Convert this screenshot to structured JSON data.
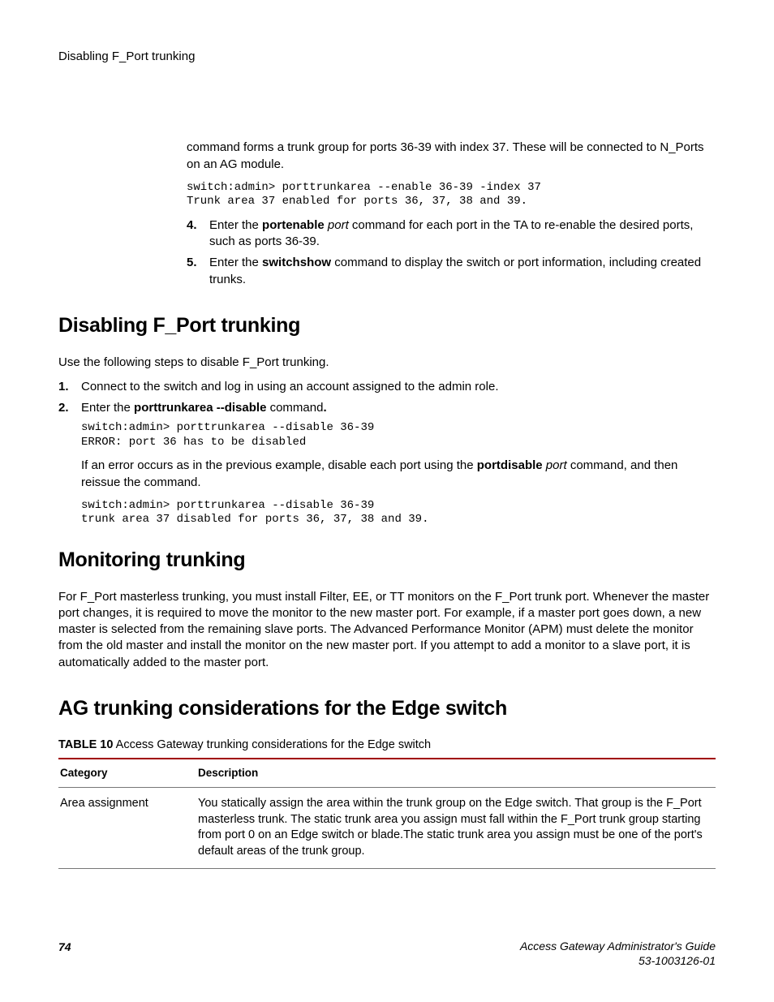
{
  "header": {
    "breadcrumb": "Disabling F_Port trunking"
  },
  "intro": {
    "p1": "command forms a trunk group for ports 36-39 with index 37. These will be connected to N_Ports on an AG module.",
    "code1": "switch:admin> porttrunkarea --enable 36-39 -index 37\nTrunk area 37 enabled for ports 36, 37, 38 and 39.",
    "step4_marker": "4.",
    "step4_pre": "Enter the ",
    "step4_b1": "portenable",
    "step4_i1": " port ",
    "step4_post": "command for each port in the TA to re-enable the desired ports, such as ports 36-39.",
    "step5_marker": "5.",
    "step5_pre": "Enter the ",
    "step5_b1": "switchshow",
    "step5_post": " command to display the switch or port information, including created trunks."
  },
  "disabling": {
    "heading": "Disabling F_Port trunking",
    "p1": "Use the following steps to disable F_Port trunking.",
    "s1_marker": "1.",
    "s1_text": "Connect to the switch and log in using an account assigned to the admin role.",
    "s2_marker": "2.",
    "s2_pre": "Enter the ",
    "s2_b1": "porttrunkarea --disable",
    "s2_post": " command",
    "s2_bperiod": ".",
    "code1": "switch:admin> porttrunkarea --disable 36-39\nERROR: port 36 has to be disabled",
    "p2_pre": "If an error occurs as in the previous example, disable each port using the ",
    "p2_b1": "portdisable",
    "p2_i1": " port ",
    "p2_post": "command, and then reissue the command.",
    "code2": "switch:admin> porttrunkarea --disable 36-39\ntrunk area 37 disabled for ports 36, 37, 38 and 39."
  },
  "monitoring": {
    "heading": "Monitoring trunking",
    "p1": "For F_Port masterless trunking, you must install Filter, EE, or TT monitors on the F_Port trunk port. Whenever the master port changes, it is required to move the monitor to the new master port. For example, if a master port goes down, a new master is selected from the remaining slave ports. The Advanced Performance Monitor (APM) must delete the monitor from the old master and install the monitor on the new master port. If you attempt to add a monitor to a slave port, it is automatically added to the master port."
  },
  "ag": {
    "heading": "AG trunking considerations for the Edge switch",
    "caption_label": "TABLE 10",
    "caption_text": "   Access Gateway trunking considerations for the Edge switch",
    "th_cat": "Category",
    "th_desc": "Description",
    "row1_cat": "Area assignment",
    "row1_desc": "You statically assign the area within the trunk group on the Edge switch. That group is the F_Port masterless trunk. The static trunk area you assign must fall within the F_Port trunk group starting from port 0 on an Edge switch or blade.The static trunk area you assign must be one of the port's default areas of the trunk group."
  },
  "footer": {
    "page": "74",
    "guide": "Access Gateway Administrator's Guide",
    "docid": "53-1003126-01"
  }
}
